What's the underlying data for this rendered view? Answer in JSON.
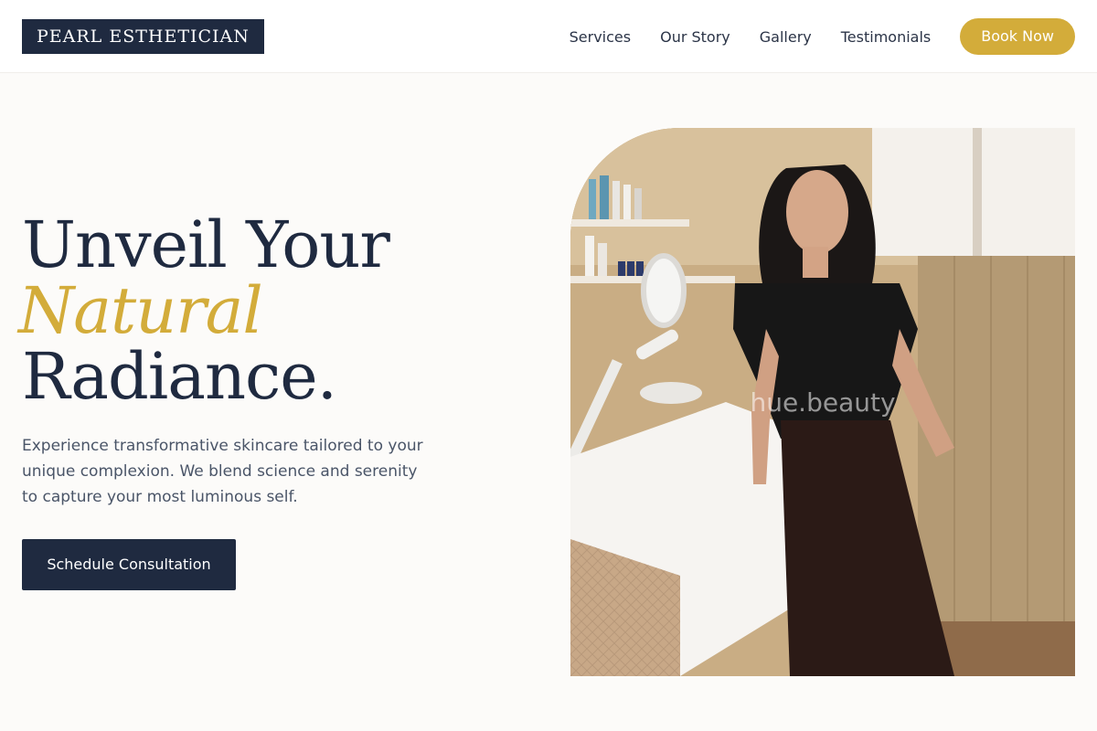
{
  "header": {
    "logo_text": "PEARL ESTHETICIAN",
    "nav_items": [
      "Services",
      "Our Story",
      "Gallery",
      "Testimonials"
    ],
    "cta_label": "Book Now"
  },
  "hero": {
    "title_line1": "Unveil Your",
    "title_accent": "Natural",
    "title_line3": "Radiance.",
    "subtitle": "Experience transformative skincare tailored to your unique complexion. We blend science and serenity to capture your most luminous self.",
    "cta_label": "Schedule Consultation",
    "image_watermark": "hue.beauty"
  },
  "colors": {
    "navy": "#1f2a40",
    "gold": "#d3ac3a",
    "background": "#fcfbf9"
  }
}
